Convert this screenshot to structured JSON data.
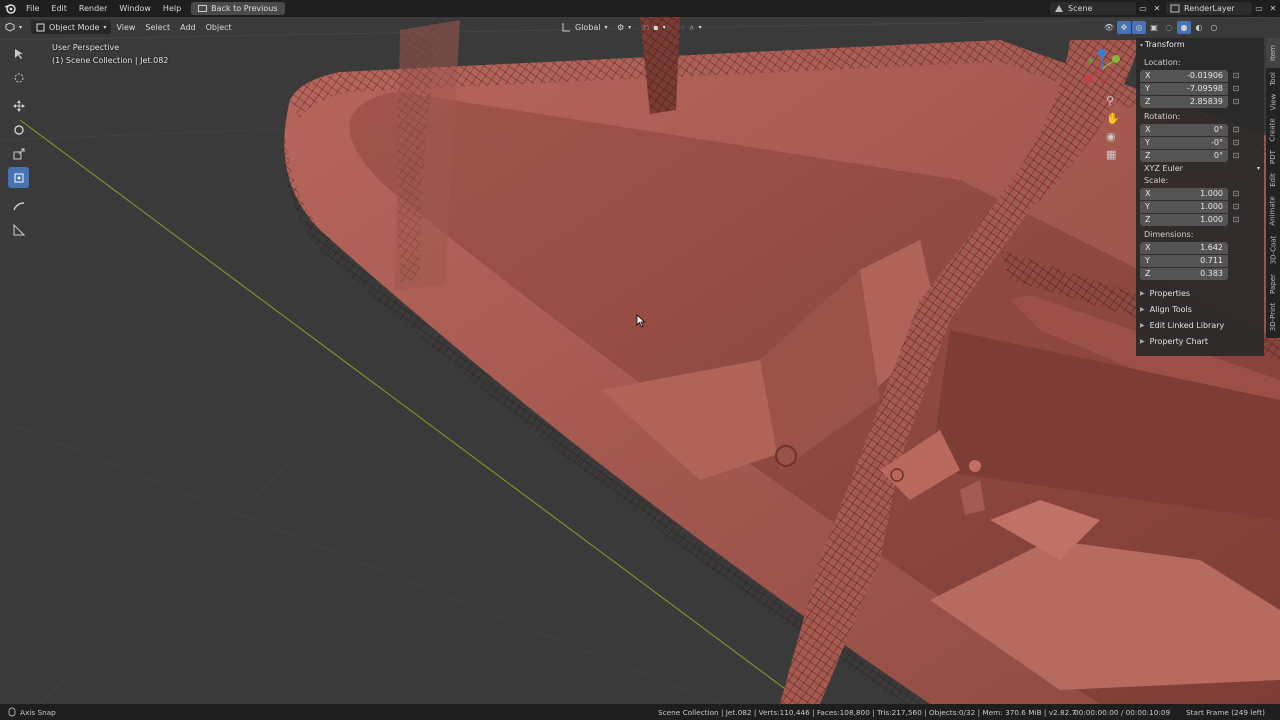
{
  "topbar": {
    "menu": [
      "File",
      "Edit",
      "Render",
      "Window",
      "Help"
    ],
    "back_button": "Back to Previous",
    "scene": "Scene",
    "render_layer": "RenderLayer"
  },
  "header": {
    "mode": "Object Mode",
    "menu": [
      "View",
      "Select",
      "Add",
      "Object"
    ],
    "transform_orientation": "Global"
  },
  "viewport": {
    "perspective": "User Perspective",
    "collection": "(1) Scene Collection | Jet.082"
  },
  "transform_panel": {
    "title": "Transform",
    "location_label": "Location:",
    "location": [
      {
        "axis": "X",
        "value": "-0.01906"
      },
      {
        "axis": "Y",
        "value": "-7.09598"
      },
      {
        "axis": "Z",
        "value": "2.85839"
      }
    ],
    "rotation_label": "Rotation:",
    "rotation": [
      {
        "axis": "X",
        "value": "0°"
      },
      {
        "axis": "Y",
        "value": "-0°"
      },
      {
        "axis": "Z",
        "value": "0°"
      }
    ],
    "rotation_mode": "XYZ Euler",
    "scale_label": "Scale:",
    "scale": [
      {
        "axis": "X",
        "value": "1.000"
      },
      {
        "axis": "Y",
        "value": "1.000"
      },
      {
        "axis": "Z",
        "value": "1.000"
      }
    ],
    "dimensions_label": "Dimensions:",
    "dimensions": [
      {
        "axis": "X",
        "value": "1.642"
      },
      {
        "axis": "Y",
        "value": "0.711"
      },
      {
        "axis": "Z",
        "value": "0.383"
      }
    ]
  },
  "sections": [
    "Properties",
    "Align Tools",
    "Edit Linked Library",
    "Property Chart"
  ],
  "side_tabs": [
    "Tool",
    "View",
    "Create",
    "PDT",
    "Edit",
    "Animate",
    "3D-Coat",
    "Paper",
    "3D-Print"
  ],
  "status": {
    "left": "Axis Snap",
    "stats": "Scene Collection | Jet.082 | Verts:110,446 | Faces:108,800 | Tris:217,560 | Objects:0/32 | Mem: 370.6 MiB | v2.82.7",
    "time": "00:00:00:00 / 00:00:10:09",
    "frame": "Start Frame (249 left)"
  },
  "colors": {
    "accent": "#4772b3",
    "model": "#a6584f",
    "background": "#3a3a3a"
  }
}
